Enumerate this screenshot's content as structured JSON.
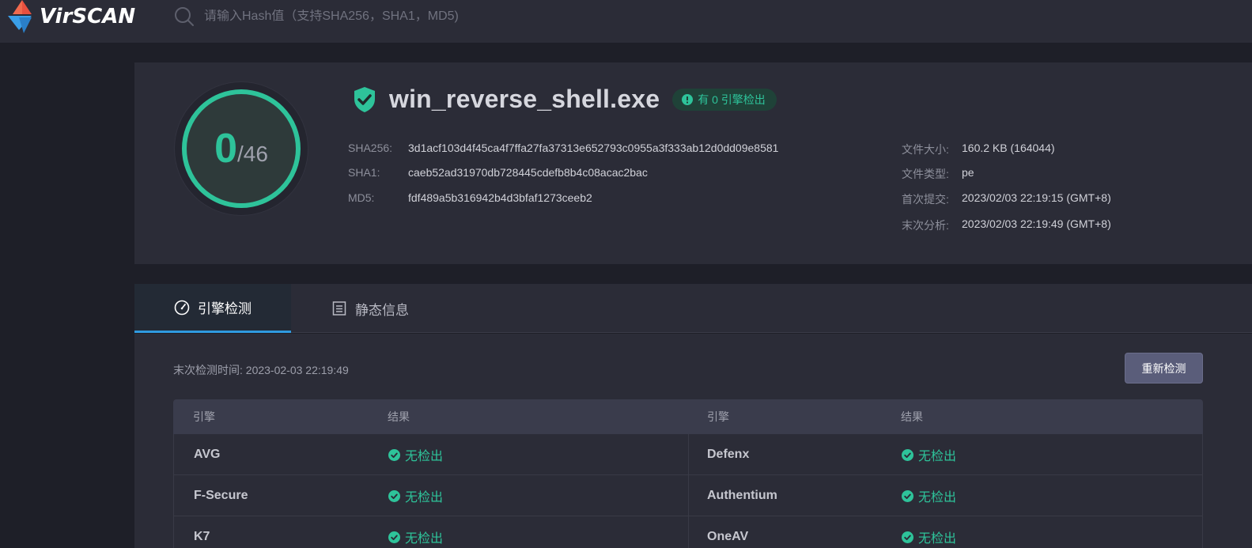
{
  "app": {
    "logo_text": "VirSCAN"
  },
  "search": {
    "placeholder": "请输入Hash值（支持SHA256，SHA1，MD5)"
  },
  "score": {
    "detected": "0",
    "total": "/46"
  },
  "file": {
    "name": "win_reverse_shell.exe",
    "badge": "有 0 引擎检出",
    "hashes": [
      {
        "label": "SHA256:",
        "value": "3d1acf103d4f45ca4f7ffa27fa37313e652793c0955a3f333ab12d0dd09e8581"
      },
      {
        "label": "SHA1:",
        "value": "caeb52ad31970db728445cdefb8b4c08acac2bac"
      },
      {
        "label": "MD5:",
        "value": "fdf489a5b316942b4d3bfaf1273ceeb2"
      }
    ],
    "meta": [
      {
        "label": "文件大小:",
        "value": "160.2 KB (164044)"
      },
      {
        "label": "文件类型:",
        "value": "pe"
      },
      {
        "label": "首次提交:",
        "value": "2023/02/03 22:19:15 (GMT+8)"
      },
      {
        "label": "末次分析:",
        "value": "2023/02/03 22:19:49 (GMT+8)"
      }
    ]
  },
  "tabs": [
    {
      "label": "引擎检测",
      "icon": "gauge-icon"
    },
    {
      "label": "静态信息",
      "icon": "document-icon"
    }
  ],
  "scan": {
    "last_time": "末次检测时间: 2023-02-03 22:19:49",
    "rescan_label": "重新检测"
  },
  "table": {
    "headers": [
      "引擎",
      "结果",
      "引擎",
      "结果"
    ],
    "rows": [
      {
        "left_engine": "AVG",
        "left_result": "无检出",
        "right_engine": "Defenx",
        "right_result": "无检出"
      },
      {
        "left_engine": "F-Secure",
        "left_result": "无检出",
        "right_engine": "Authentium",
        "right_result": "无检出"
      },
      {
        "left_engine": "K7",
        "left_result": "无检出",
        "right_engine": "OneAV",
        "right_result": "无检出"
      }
    ]
  },
  "colors": {
    "accent_green": "#2ec39a",
    "tab_active_border": "#2f9ae0",
    "background": "#1e1f28",
    "panel": "#2b2c37"
  }
}
